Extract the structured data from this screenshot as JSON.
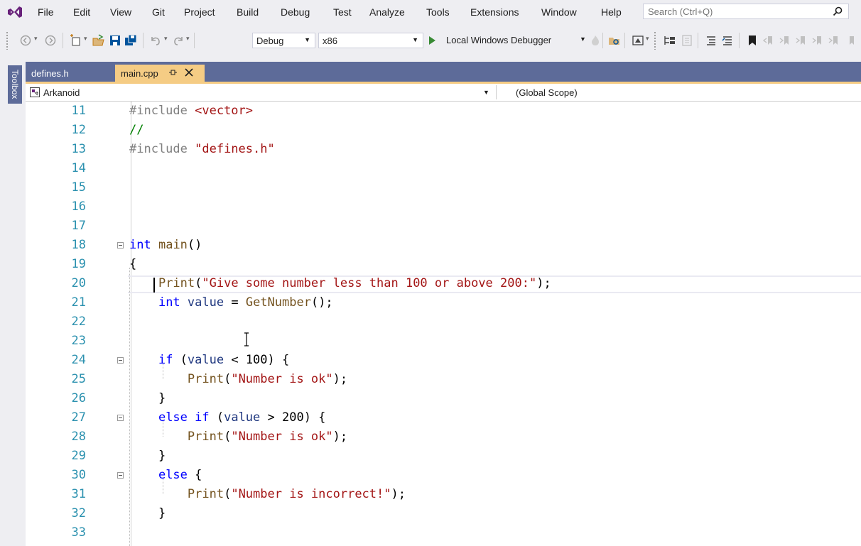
{
  "menu": {
    "items": [
      "File",
      "Edit",
      "View",
      "Git",
      "Project",
      "Build",
      "Debug",
      "Test",
      "Analyze",
      "Tools",
      "Extensions",
      "Window",
      "Help"
    ],
    "search_placeholder": "Search (Ctrl+Q)"
  },
  "toolbar": {
    "configuration": "Debug",
    "platform": "x86",
    "run_label": "Local Windows Debugger"
  },
  "toolbox": {
    "label": "Toolbox"
  },
  "tabs": [
    {
      "label": "defines.h",
      "active": false
    },
    {
      "label": "main.cpp",
      "active": true
    }
  ],
  "navbar": {
    "project": "Arkanoid",
    "scope": "(Global Scope)"
  },
  "editor": {
    "current_line": 20,
    "lines": [
      {
        "num": "11",
        "tokens": [
          [
            "pp",
            "#include "
          ],
          [
            "str",
            "<vector>"
          ]
        ]
      },
      {
        "num": "12",
        "tokens": [
          [
            "cm",
            "//"
          ]
        ]
      },
      {
        "num": "13",
        "tokens": [
          [
            "pp",
            "#include "
          ],
          [
            "str",
            "\"defines.h\""
          ]
        ]
      },
      {
        "num": "14",
        "tokens": []
      },
      {
        "num": "15",
        "tokens": []
      },
      {
        "num": "16",
        "tokens": []
      },
      {
        "num": "17",
        "tokens": []
      },
      {
        "num": "18",
        "tokens": [
          [
            "kw",
            "int"
          ],
          [
            "pn",
            " "
          ],
          [
            "fn",
            "main"
          ],
          [
            "pn",
            "()"
          ]
        ]
      },
      {
        "num": "19",
        "tokens": [
          [
            "pn",
            "{"
          ]
        ]
      },
      {
        "num": "20",
        "tokens": [
          [
            "pn",
            "    "
          ],
          [
            "fn",
            "Print"
          ],
          [
            "pn",
            "("
          ],
          [
            "str",
            "\"Give some number less than 100 or above 200:\""
          ],
          [
            "pn",
            ");"
          ]
        ]
      },
      {
        "num": "21",
        "tokens": [
          [
            "pn",
            "    "
          ],
          [
            "kw",
            "int"
          ],
          [
            "pn",
            " "
          ],
          [
            "id",
            "value"
          ],
          [
            "pn",
            " = "
          ],
          [
            "fn",
            "GetNumber"
          ],
          [
            "pn",
            "();"
          ]
        ]
      },
      {
        "num": "22",
        "tokens": []
      },
      {
        "num": "23",
        "tokens": []
      },
      {
        "num": "24",
        "tokens": [
          [
            "pn",
            "    "
          ],
          [
            "kw",
            "if"
          ],
          [
            "pn",
            " ("
          ],
          [
            "id",
            "value"
          ],
          [
            "pn",
            " < 100) {"
          ]
        ]
      },
      {
        "num": "25",
        "tokens": [
          [
            "pn",
            "        "
          ],
          [
            "fn",
            "Print"
          ],
          [
            "pn",
            "("
          ],
          [
            "str",
            "\"Number is ok\""
          ],
          [
            "pn",
            ");"
          ]
        ]
      },
      {
        "num": "26",
        "tokens": [
          [
            "pn",
            "    }"
          ]
        ]
      },
      {
        "num": "27",
        "tokens": [
          [
            "pn",
            "    "
          ],
          [
            "kw",
            "else if"
          ],
          [
            "pn",
            " ("
          ],
          [
            "id",
            "value"
          ],
          [
            "pn",
            " > 200) {"
          ]
        ]
      },
      {
        "num": "28",
        "tokens": [
          [
            "pn",
            "        "
          ],
          [
            "fn",
            "Print"
          ],
          [
            "pn",
            "("
          ],
          [
            "str",
            "\"Number is ok\""
          ],
          [
            "pn",
            ");"
          ]
        ]
      },
      {
        "num": "29",
        "tokens": [
          [
            "pn",
            "    }"
          ]
        ]
      },
      {
        "num": "30",
        "tokens": [
          [
            "pn",
            "    "
          ],
          [
            "kw",
            "else"
          ],
          [
            "pn",
            " {"
          ]
        ]
      },
      {
        "num": "31",
        "tokens": [
          [
            "pn",
            "        "
          ],
          [
            "fn",
            "Print"
          ],
          [
            "pn",
            "("
          ],
          [
            "str",
            "\"Number is incorrect!\""
          ],
          [
            "pn",
            ");"
          ]
        ]
      },
      {
        "num": "32",
        "tokens": [
          [
            "pn",
            "    }"
          ]
        ]
      },
      {
        "num": "33",
        "tokens": []
      }
    ],
    "fold_lines": [
      "18",
      "24",
      "27",
      "30"
    ]
  },
  "colors": {
    "tab_active": "#f5cc84",
    "tab_bar": "#5d6b99",
    "line_number": "#2b91af",
    "keyword": "#0000ff",
    "string": "#a31515",
    "comment": "#008000",
    "function": "#74531f",
    "run_play": "#388a34"
  }
}
